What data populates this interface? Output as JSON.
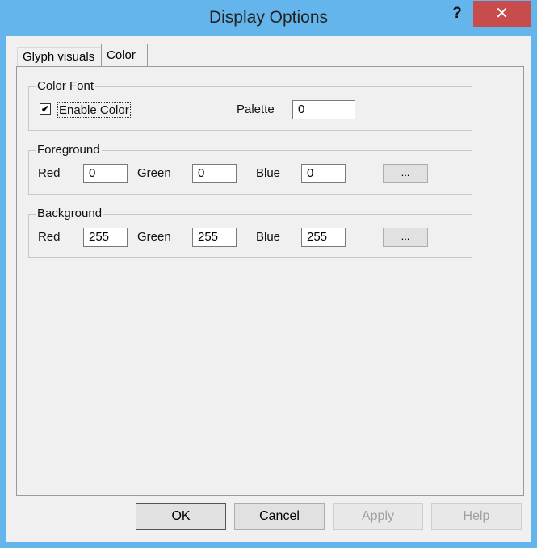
{
  "window": {
    "title": "Display Options",
    "help_glyph": "?",
    "close_glyph": "✕"
  },
  "tabs": [
    {
      "label": "Glyph visuals",
      "selected": false
    },
    {
      "label": "Color",
      "selected": true
    }
  ],
  "color_font": {
    "title": "Color Font",
    "enable_label": "Enable Color",
    "enable_checked": "✔",
    "palette_label": "Palette",
    "palette_value": "0"
  },
  "foreground": {
    "title": "Foreground",
    "red_label": "Red",
    "red": "0",
    "green_label": "Green",
    "green": "0",
    "blue_label": "Blue",
    "blue": "0",
    "pick_label": "..."
  },
  "background": {
    "title": "Background",
    "red_label": "Red",
    "red": "255",
    "green_label": "Green",
    "green": "255",
    "blue_label": "Blue",
    "blue": "255",
    "pick_label": "..."
  },
  "buttons": {
    "ok": "OK",
    "cancel": "Cancel",
    "apply": "Apply",
    "help": "Help"
  }
}
